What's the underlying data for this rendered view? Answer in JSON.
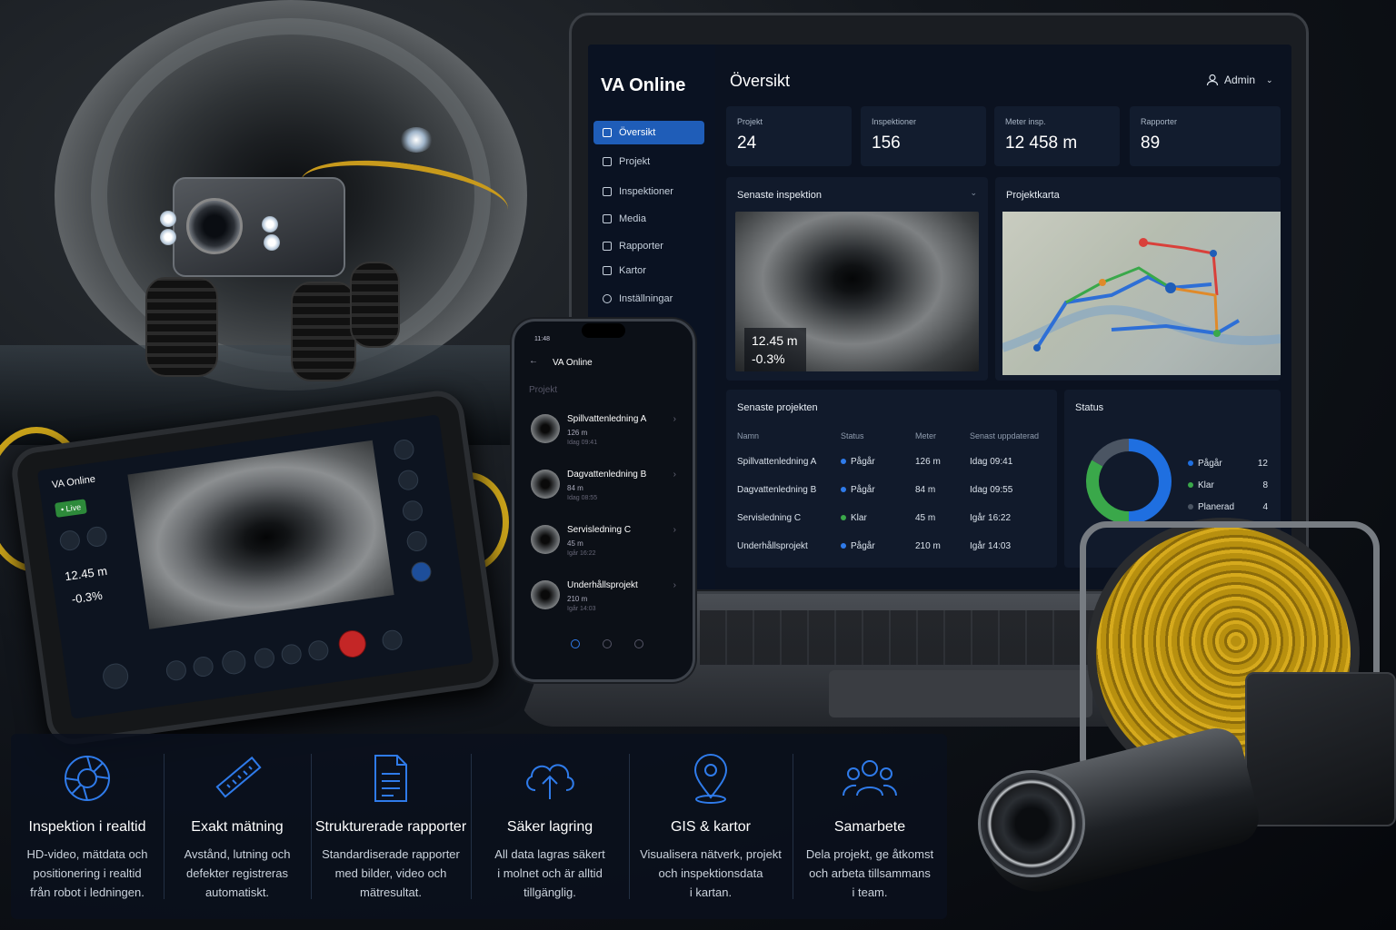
{
  "dashboard": {
    "brand": "VA Online",
    "title": "Översikt",
    "user": "Admin",
    "nav": [
      {
        "label": "Översikt",
        "icon": "home-icon",
        "active": true
      },
      {
        "label": "Projekt",
        "icon": "folder-icon"
      },
      {
        "label": "Inspektioner",
        "icon": "clipboard-icon"
      },
      {
        "label": "Media",
        "icon": "media-icon"
      },
      {
        "label": "Rapporter",
        "icon": "report-icon"
      },
      {
        "label": "Kartor",
        "icon": "map-icon"
      },
      {
        "label": "Inställningar",
        "icon": "gear-icon"
      }
    ],
    "stats": [
      {
        "label": "Projekt",
        "value": "24"
      },
      {
        "label": "Inspektioner",
        "value": "156"
      },
      {
        "label": "Meter insp.",
        "value": "12 458 m"
      },
      {
        "label": "Rapporter",
        "value": "89"
      }
    ],
    "latest_inspection": {
      "title": "Senaste inspektion",
      "distance": "12.45 m",
      "slope": "-0.3%"
    },
    "map_title": "Projektkarta",
    "projects_table": {
      "title": "Senaste projekten",
      "headers": [
        "Namn",
        "Status",
        "Meter",
        "Senast uppdaterad"
      ],
      "rows": [
        {
          "name": "Spillvattenledning A",
          "status": "Pågår",
          "status_color": "#2f7bea",
          "meter": "126 m",
          "updated": "Idag 09:41"
        },
        {
          "name": "Dagvattenledning B",
          "status": "Pågår",
          "status_color": "#2f7bea",
          "meter": "84 m",
          "updated": "Idag 09:55"
        },
        {
          "name": "Servisledning C",
          "status": "Klar",
          "status_color": "#3aa84a",
          "meter": "45 m",
          "updated": "Igår 16:22"
        },
        {
          "name": "Underhållsprojekt",
          "status": "Pågår",
          "status_color": "#2f7bea",
          "meter": "210 m",
          "updated": "Igår 14:03"
        }
      ]
    },
    "status_panel": {
      "title": "Status",
      "items": [
        {
          "label": "Pågår",
          "value": 12,
          "color": "#1f6fe0"
        },
        {
          "label": "Klar",
          "value": 8,
          "color": "#3aa84a"
        },
        {
          "label": "Planerad",
          "value": 4,
          "color": "#4b5563"
        }
      ]
    }
  },
  "phone": {
    "time": "11:48",
    "title": "VA Online",
    "section": "Projekt",
    "items": [
      {
        "name": "Spillvattenledning A",
        "meter": "126 m",
        "updated": "Idag 09:41"
      },
      {
        "name": "Dagvattenledning B",
        "meter": "84 m",
        "updated": "Idag 08:55"
      },
      {
        "name": "Servisledning C",
        "meter": "45 m",
        "updated": "Igår 16:22"
      },
      {
        "name": "Underhållsprojekt",
        "meter": "210 m",
        "updated": "Igår 14:03"
      }
    ]
  },
  "tablet": {
    "title": "VA Online",
    "live": "• Live",
    "distance": "12.45 m",
    "slope": "-0.3%"
  },
  "features": [
    {
      "icon": "aperture-icon",
      "title": "Inspektion i realtid",
      "desc": "HD-video, mätdata och\npositionering i realtid\nfrån robot i ledningen."
    },
    {
      "icon": "ruler-icon",
      "title": "Exakt mätning",
      "desc": "Avstånd, lutning och\ndefekter registreras\nautomatiskt."
    },
    {
      "icon": "document-icon",
      "title": "Strukturerade rapporter",
      "desc": "Standardiserade rapporter\nmed bilder, video och\nmätresultat."
    },
    {
      "icon": "cloud-upload-icon",
      "title": "Säker lagring",
      "desc": "All data lagras säkert\ni molnet och är alltid\ntillgänglig."
    },
    {
      "icon": "location-pin-icon",
      "title": "GIS & kartor",
      "desc": "Visualisera nätverk, projekt\noch inspektionsdata\ni kartan."
    },
    {
      "icon": "team-icon",
      "title": "Samarbete",
      "desc": "Dela projekt, ge åtkomst\noch arbeta tillsammans\ni team."
    }
  ],
  "accent_color": "#1f5db8"
}
